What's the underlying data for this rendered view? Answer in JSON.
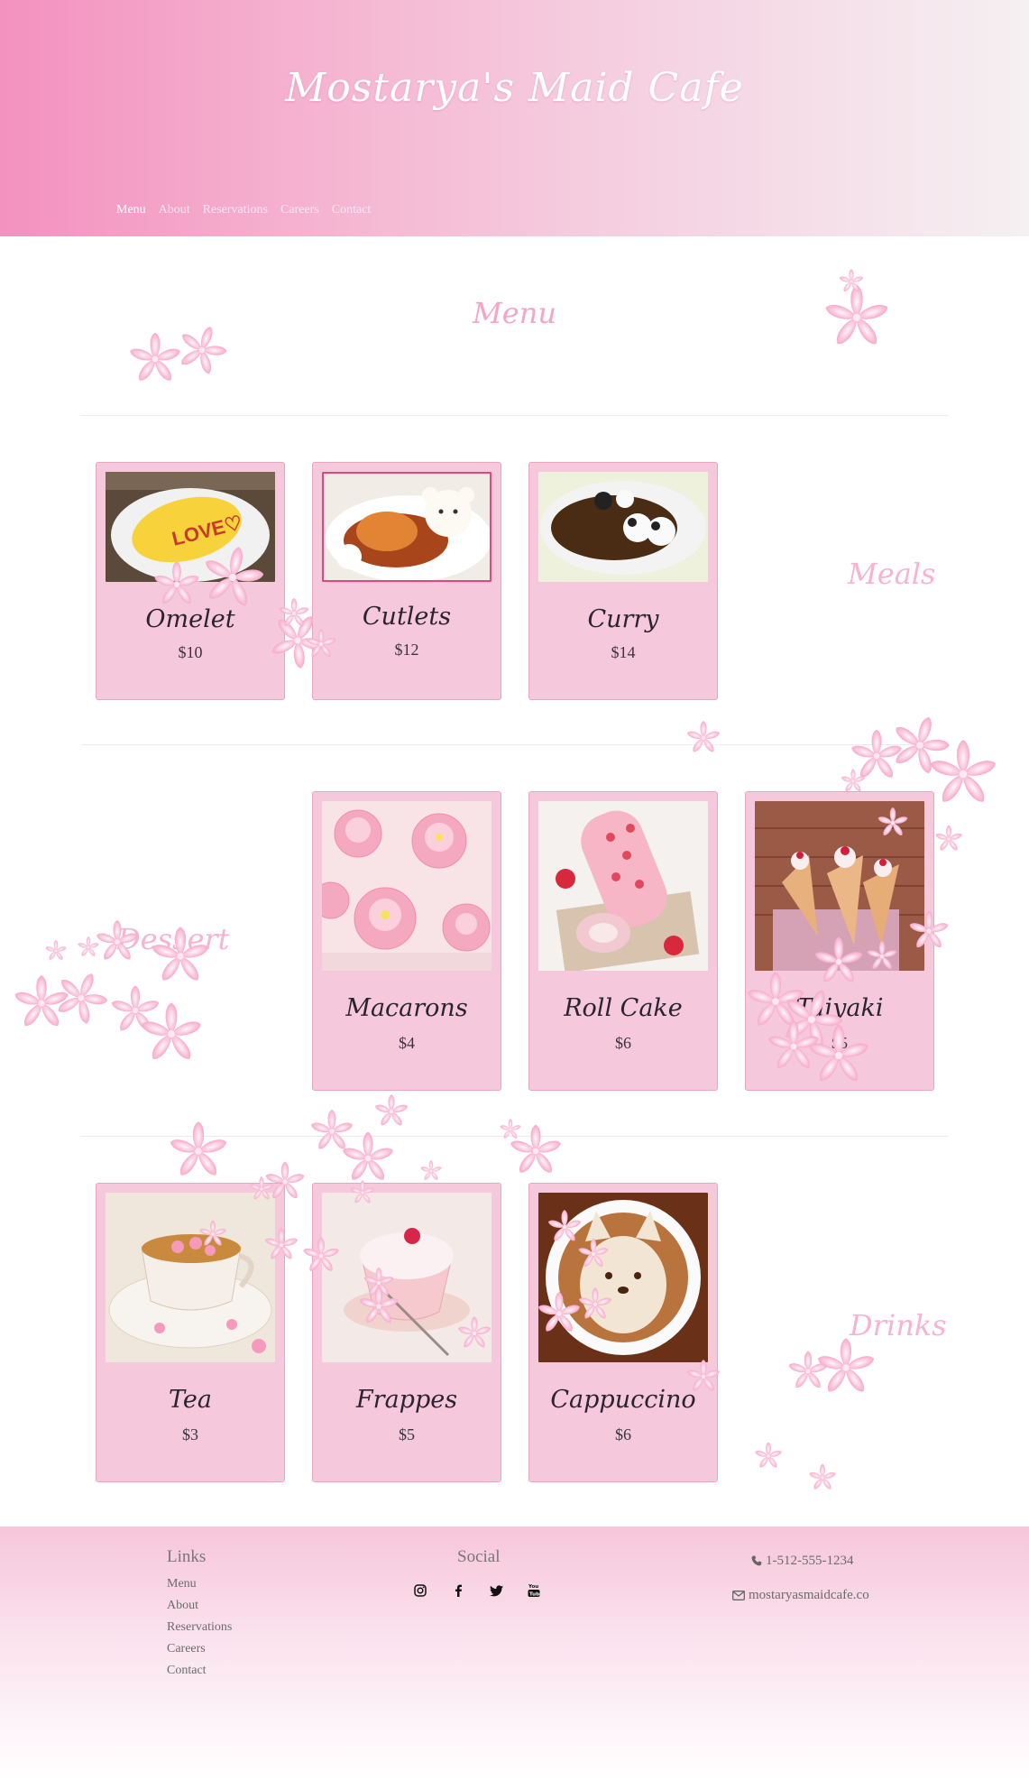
{
  "site": {
    "title": "Mostarya's Maid Cafe"
  },
  "nav": {
    "items": [
      {
        "label": "Menu",
        "active": true
      },
      {
        "label": "About",
        "active": false
      },
      {
        "label": "Reservations",
        "active": false
      },
      {
        "label": "Careers",
        "active": false
      },
      {
        "label": "Contact",
        "active": false
      }
    ]
  },
  "menu": {
    "heading": "Menu",
    "meals": {
      "label": "Meals",
      "items": [
        {
          "name": "Omelet",
          "price": "$10",
          "photo": "omelet-photo"
        },
        {
          "name": "Cutlets",
          "price": "$12",
          "photo": "cutlets-photo"
        },
        {
          "name": "Curry",
          "price": "$14",
          "photo": "curry-photo"
        }
      ]
    },
    "desserts": {
      "label": "Dessert",
      "items": [
        {
          "name": "Macarons",
          "price": "$4",
          "photo": "macarons-photo"
        },
        {
          "name": "Roll Cake",
          "price": "$6",
          "photo": "roll-cake-photo"
        },
        {
          "name": "Taiyaki",
          "price": "$5",
          "photo": "taiyaki-photo"
        }
      ]
    },
    "drinks": {
      "label": "Drinks",
      "items": [
        {
          "name": "Tea",
          "price": "$3",
          "photo": "tea-photo"
        },
        {
          "name": "Frappes",
          "price": "$5",
          "photo": "frappes-photo"
        },
        {
          "name": "Cappuccino",
          "price": "$6",
          "photo": "cappuccino-photo"
        }
      ]
    }
  },
  "footer": {
    "links_heading": "Links",
    "links": [
      "Menu",
      "About",
      "Reservations",
      "Careers",
      "Contact"
    ],
    "social_heading": "Social",
    "social_icons": [
      "instagram-icon",
      "facebook-icon",
      "twitter-icon",
      "youtube-icon"
    ],
    "phone": "1-512-555-1234",
    "email": "mostaryasmaidcafe.co"
  },
  "colors": {
    "header_start": "#f391bf",
    "card_bg": "#f6c8dc",
    "accent_pink": "#f5a6c8"
  }
}
